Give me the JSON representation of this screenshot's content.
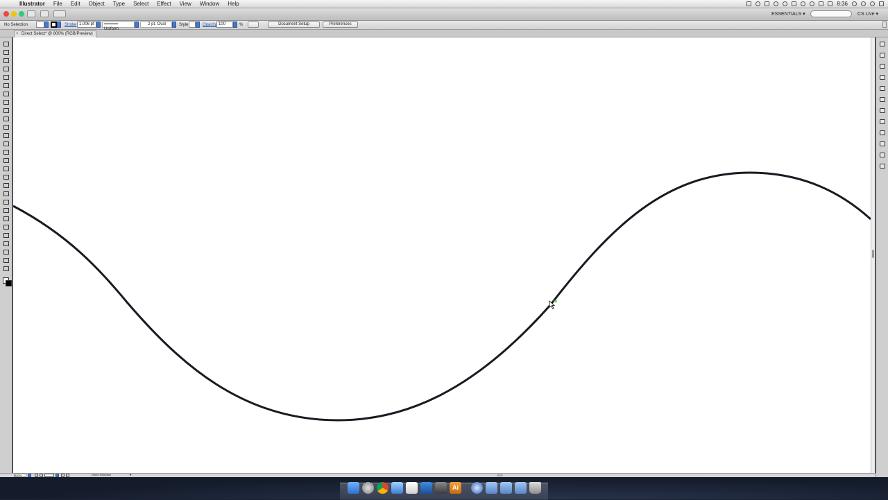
{
  "menubar": {
    "app_name": "Illustrator",
    "items": [
      "File",
      "Edit",
      "Object",
      "Type",
      "Select",
      "Effect",
      "View",
      "Window",
      "Help"
    ],
    "clock": "8:36"
  },
  "titlebar": {
    "workspace": "ESSENTIALS ▾",
    "cs_live": "CS Live ▾"
  },
  "controlbar": {
    "selection_status": "No Selection",
    "stroke_label": "Stroke",
    "stroke_weight": "1.006 pt",
    "stroke_profile": "Uniform",
    "brush": "2 pt. Oval",
    "style_label": "Style",
    "opacity_label": "Opacity",
    "opacity_value": "100",
    "opacity_unit": "%",
    "document_setup": "Document Setup",
    "preferences": "Preferences"
  },
  "document": {
    "tab_title": "Direct Select* @ 800% (RGB/Preview)"
  },
  "statusbar": {
    "zoom": "800%",
    "current_tool": "Direct Selection"
  },
  "colors": {
    "accent_blue": "#2a5db0",
    "fill_swatch": "#ffffff",
    "stroke_swatch": "#000000",
    "path_stroke": "#1a1a22",
    "anchor_highlight": "#47d14a"
  },
  "icons": {
    "tools": [
      "selection-tool-icon",
      "direct-selection-tool-icon",
      "magic-wand-tool-icon",
      "lasso-tool-icon",
      "pen-tool-icon",
      "type-tool-icon",
      "line-tool-icon",
      "ellipse-tool-icon",
      "paintbrush-tool-icon",
      "pencil-tool-icon",
      "blob-brush-tool-icon",
      "eraser-tool-icon",
      "rotate-tool-icon",
      "scale-tool-icon",
      "width-tool-icon",
      "free-transform-tool-icon",
      "shape-builder-tool-icon",
      "perspective-grid-tool-icon",
      "mesh-tool-icon",
      "gradient-tool-icon",
      "eyedropper-tool-icon",
      "blend-tool-icon",
      "symbol-sprayer-tool-icon",
      "column-graph-tool-icon",
      "artboard-tool-icon",
      "slice-tool-icon",
      "hand-tool-icon",
      "zoom-tool-icon"
    ],
    "panels": [
      "color-panel-icon",
      "color-guide-panel-icon",
      "swatches-panel-icon",
      "brushes-panel-icon",
      "symbols-panel-icon",
      "stroke-panel-icon",
      "gradient-panel-icon",
      "transparency-panel-icon",
      "appearance-panel-icon",
      "graphic-styles-panel-icon",
      "layers-panel-icon",
      "artboards-panel-icon"
    ]
  },
  "dock": {
    "illustrator_label": "Ai"
  }
}
